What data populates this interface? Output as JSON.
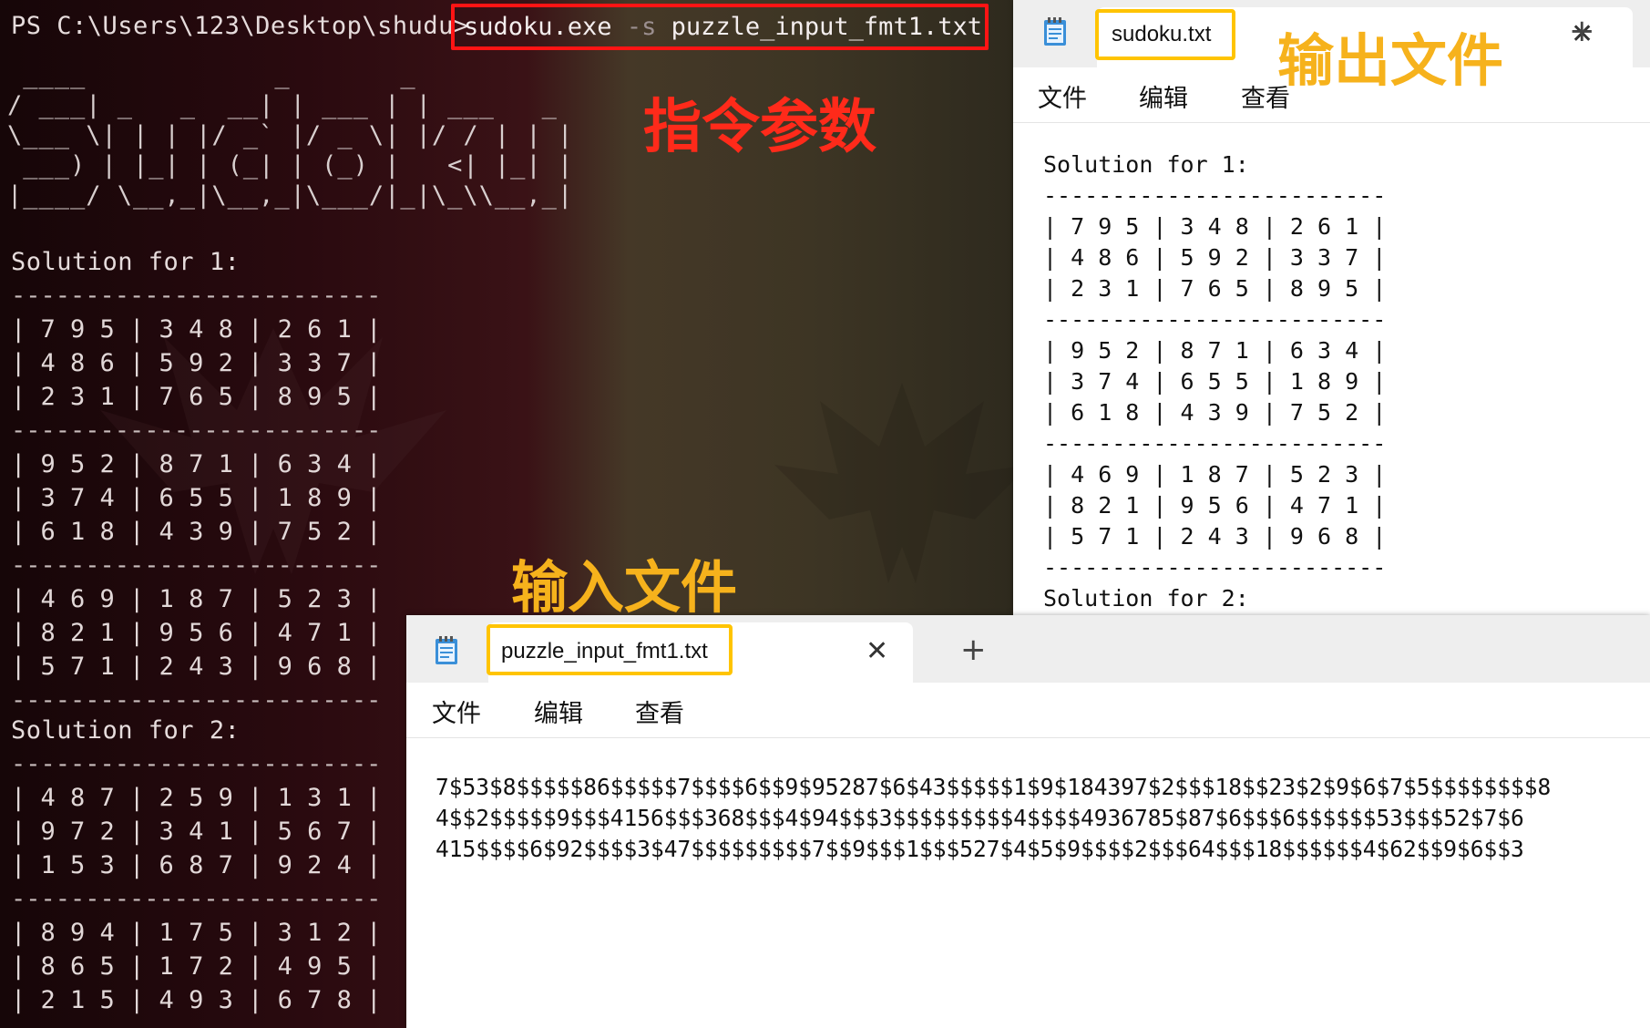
{
  "terminal": {
    "prompt": "PS C:\\Users\\123\\Desktop\\shudu>",
    "command": "sudoku.exe",
    "flag": "-s",
    "argument": "puzzle_input_fmt1.txt",
    "ascii_banner": [
      " ____            _       _          ",
      "/ ___| _   _  __| | ___ | | ___   _ ",
      "\\___ \\| | | |/ _` |/ _ \\| |/ / | | |",
      " ___) | |_| | (_| | (_) |   <| |_| |",
      "|____/ \\__,_|\\__,_|\\___/|_|\\_\\\\__,_|"
    ],
    "solution1_title": "Solution for 1:",
    "solution2_title": "Solution for 2:",
    "separator": "-------------------------",
    "solution1_rows": [
      "| 7 9 5 | 3 4 8 | 2 6 1 |",
      "| 4 8 6 | 5 9 2 | 3 3 7 |",
      "| 2 3 1 | 7 6 5 | 8 9 5 |",
      "| 9 5 2 | 8 7 1 | 6 3 4 |",
      "| 3 7 4 | 6 5 5 | 1 8 9 |",
      "| 6 1 8 | 4 3 9 | 7 5 2 |",
      "| 4 6 9 | 1 8 7 | 5 2 3 |",
      "| 8 2 1 | 9 5 6 | 4 7 1 |",
      "| 5 7 1 | 2 4 3 | 9 6 8 |"
    ],
    "solution2_rows": [
      "| 4 8 7 | 2 5 9 | 1 3 1 |",
      "| 9 7 2 | 3 4 1 | 5 6 7 |",
      "| 1 5 3 | 6 8 7 | 9 2 4 |",
      "| 8 9 4 | 1 7 5 | 3 1 2 |",
      "| 8 6 5 | 1 7 2 | 4 9 5 |",
      "| 2 1 5 | 4 9 3 | 6 7 8 |"
    ]
  },
  "annotations": {
    "command_params": "指令参数",
    "input_file": "输入文件",
    "output_file": "输出文件"
  },
  "output_window": {
    "tab_title": "sudoku.txt",
    "menu": [
      "文件",
      "编辑",
      "查看"
    ],
    "solution1_title": "Solution for 1:",
    "solution2_title": "Solution for 2:",
    "separator": "-------------------------",
    "rows": [
      "| 7 9 5 | 3 4 8 | 2 6 1 |",
      "| 4 8 6 | 5 9 2 | 3 3 7 |",
      "| 2 3 1 | 7 6 5 | 8 9 5 |",
      "| 9 5 2 | 8 7 1 | 6 3 4 |",
      "| 3 7 4 | 6 5 5 | 1 8 9 |",
      "| 6 1 8 | 4 3 9 | 7 5 2 |",
      "| 4 6 9 | 1 8 7 | 5 2 3 |",
      "| 8 2 1 | 9 5 6 | 4 7 1 |",
      "| 5 7 1 | 2 4 3 | 9 6 8 |"
    ]
  },
  "input_window": {
    "tab_title": "puzzle_input_fmt1.txt",
    "menu": [
      "文件",
      "编辑",
      "查看"
    ],
    "lines": [
      "7$53$8$$$$$86$$$$$7$$$$6$$9$95287$6$43$$$$$1$9$184397$2$$$18$$23$2$9$6$7$5$$$$$$$$8",
      "4$$2$$$$$9$$$4156$$$368$$$4$94$$$3$$$$$$$$$4$$$$4936785$87$6$$$6$$$$$$53$$$52$7$6",
      "415$$$$6$92$$$$3$47$$$$$$$$$7$$9$$$1$$$527$4$5$9$$$$2$$$64$$$18$$$$$$4$62$$9$6$$3"
    ]
  },
  "colors": {
    "command_box": "#ff1414",
    "annotation_red": "#ff2a1a",
    "annotation_yellow": "#f6b21c",
    "tab_highlight": "#ffc400"
  },
  "icons": {
    "notepad": "notepad-icon",
    "close": "close-icon",
    "new_tab": "plus-icon"
  }
}
